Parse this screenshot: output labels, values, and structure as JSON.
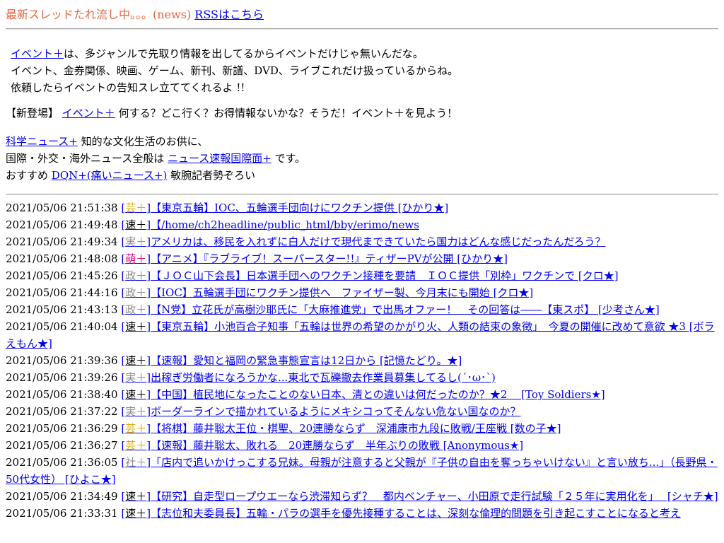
{
  "header": {
    "live_text": "最新スレッドたれ流し中。。。",
    "news_tag": "(news)",
    "rss_link": "RSSはこちら"
  },
  "intro": {
    "event_link": "イベント＋",
    "line1_rest": "は、多ジャンルで先取り情報を出してるからイベントだけじゃ無いんだな。",
    "line2": "イベント、金券関係、映画、ゲーム、新刊、新譜、DVD、ライブこれだけ扱っているからね。",
    "line3": "依頼したらイベントの告知スレ立ててくれるよ !!"
  },
  "newcomer": {
    "prefix": "【新登場】",
    "link": "イベント＋",
    "rest": "何する？どこ行く？お得情報ないかな？そうだ！イベント＋を見よう！"
  },
  "links": {
    "science_link": "科学ニュース+",
    "science_rest": "知的な文化生活のお供に、",
    "intl_prefix": "国際・外交・海外ニュース全般は",
    "intl_link": "ニュース速報国際面+",
    "intl_rest": "です。",
    "dqn_prefix": "おすすめ",
    "dqn_link": "DQN+(痛いニュース+)",
    "dqn_rest": "敏腕記者勢ぞろい"
  },
  "feed": [
    {
      "time": "2021/05/06 21:51:38",
      "cat": "芸＋",
      "cat_class": "cat-geino",
      "title": "【東京五輪】IOC、五輪選手団向けにワクチン提供 [ひかり★]"
    },
    {
      "time": "2021/05/06 21:49:48",
      "cat": "速＋",
      "cat_class": "cat-soku",
      "title": "【/home/ch2headline/public_html/bby/erimo/news"
    },
    {
      "time": "2021/05/06 21:49:34",
      "cat": "実＋",
      "cat_class": "cat-jitsu",
      "title": "アメリカは、移民を入れずに白人だけで現代まできていたら国力はどんな感じだったんだろう？"
    },
    {
      "time": "2021/05/06 21:48:08",
      "cat": "萌＋",
      "cat_class": "cat-moe",
      "title": "【アニメ】『ラブライブ！スーパースター!!』ティザーPVが公開 [ひかり★]"
    },
    {
      "time": "2021/05/06 21:45:26",
      "cat": "政＋",
      "cat_class": "cat-sei",
      "title": "【ＪＯＣ山下会長】日本選手団へのワクチン接種を要請　ＩＯＣ提供「別枠」ワクチンで [クロ★]"
    },
    {
      "time": "2021/05/06 21:44:16",
      "cat": "政＋",
      "cat_class": "cat-sei",
      "title": "【IOC】五輪選手団にワクチン提供へ　ファイザー製、今月末にも開始 [クロ★]"
    },
    {
      "time": "2021/05/06 21:43:13",
      "cat": "政＋",
      "cat_class": "cat-sei",
      "title": "【N党】立花氏が高樹沙耶氏に「大麻推進党」で出馬オファー！　その回答は――【東スポ】 [少考さん★]"
    },
    {
      "time": "2021/05/06 21:40:04",
      "cat": "速＋",
      "cat_class": "cat-soku",
      "title": "【東京五輪】小池百合子知事「五輪は世界の希望のかがり火、人類の結束の象徴」　今夏の開催に改めて意欲 ★3 [ボラえもん★]"
    },
    {
      "time": "2021/05/06 21:39:36",
      "cat": "速＋",
      "cat_class": "cat-soku",
      "title": "【速報】愛知と福岡の緊急事態宣言は12日から [記憶たどり。★]"
    },
    {
      "time": "2021/05/06 21:39:26",
      "cat": "実＋",
      "cat_class": "cat-jitsu",
      "title": "出稼ぎ労働者になろうかな...東北で瓦礫撤去作業員募集してるし(´･ω･`)"
    },
    {
      "time": "2021/05/06 21:38:40",
      "cat": "速＋",
      "cat_class": "cat-soku",
      "title": "【中国】植民地になったことのない日本、清との違いは何だったのか？★2　 [Toy Soldiers★]"
    },
    {
      "time": "2021/05/06 21:37:22",
      "cat": "実＋",
      "cat_class": "cat-jitsu",
      "title": "ボーダーラインで描かれているようにメキシコってそんない危ない国なのか？"
    },
    {
      "time": "2021/05/06 21:36:29",
      "cat": "芸＋",
      "cat_class": "cat-geino",
      "title": "【将棋】藤井聡太王位・棋聖、20連勝ならず　深浦康市九段に敗戦/王座戦 [数の子★]"
    },
    {
      "time": "2021/05/06 21:36:27",
      "cat": "芸＋",
      "cat_class": "cat-geino",
      "title": "【速報】藤井聡太、敗れる　20連勝ならず　半年ぶりの敗戦 [Anonymous★]"
    },
    {
      "time": "2021/05/06 21:36:05",
      "cat": "社＋",
      "cat_class": "cat-sha",
      "title": "「店内で追いかけっこする兄妹。母親が注意すると父親が『子供の自由を奪っちゃいけない』と言い放ち...」（長野県・50代女性） [ひよこ★]"
    },
    {
      "time": "2021/05/06 21:34:49",
      "cat": "速＋",
      "cat_class": "cat-soku",
      "title": "【研究】自走型ロープウエーなら渋滞知らず？　都内ベンチャー、小田原で走行試験「２５年に実用化を」　 [シャチ★]"
    },
    {
      "time": "2021/05/06 21:33:31",
      "cat": "速＋",
      "cat_class": "cat-soku",
      "title": "【志位和夫委員長】五輪・パラの選手を優先接種することは、深刻な倫理的問題を引き起こすことになると考え"
    }
  ]
}
